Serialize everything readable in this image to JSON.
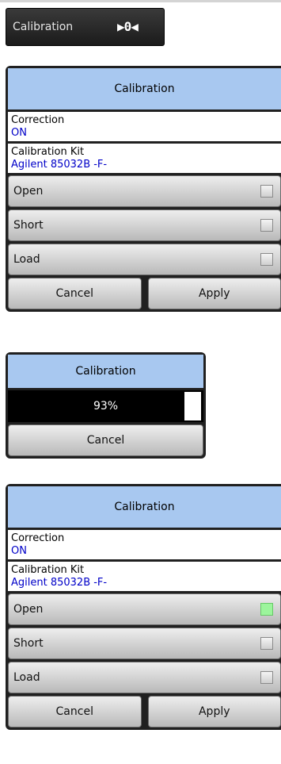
{
  "top_button": {
    "label": "Calibration",
    "icon": "calibration-icon",
    "glyph": "▶0◀"
  },
  "panel1": {
    "title": "Calibration",
    "correction": {
      "label": "Correction",
      "value": "ON"
    },
    "kit": {
      "label": "Calibration Kit",
      "value": "Agilent 85032B -F-"
    },
    "standards": [
      {
        "label": "Open",
        "done": false
      },
      {
        "label": "Short",
        "done": false
      },
      {
        "label": "Load",
        "done": false
      }
    ],
    "cancel_label": "Cancel",
    "apply_label": "Apply"
  },
  "progress_dialog": {
    "title": "Calibration",
    "progress_text": "93%",
    "progress_fraction": 0.93,
    "cancel_label": "Cancel"
  },
  "panel2": {
    "title": "Calibration",
    "correction": {
      "label": "Correction",
      "value": "ON"
    },
    "kit": {
      "label": "Calibration Kit",
      "value": "Agilent 85032B -F-"
    },
    "standards": [
      {
        "label": "Open",
        "done": true
      },
      {
        "label": "Short",
        "done": false
      },
      {
        "label": "Load",
        "done": false
      }
    ],
    "cancel_label": "Cancel",
    "apply_label": "Apply"
  },
  "colors": {
    "header": "#a8c8f0",
    "value_text": "#0000c8",
    "indicator_done": "#9cf59c"
  }
}
